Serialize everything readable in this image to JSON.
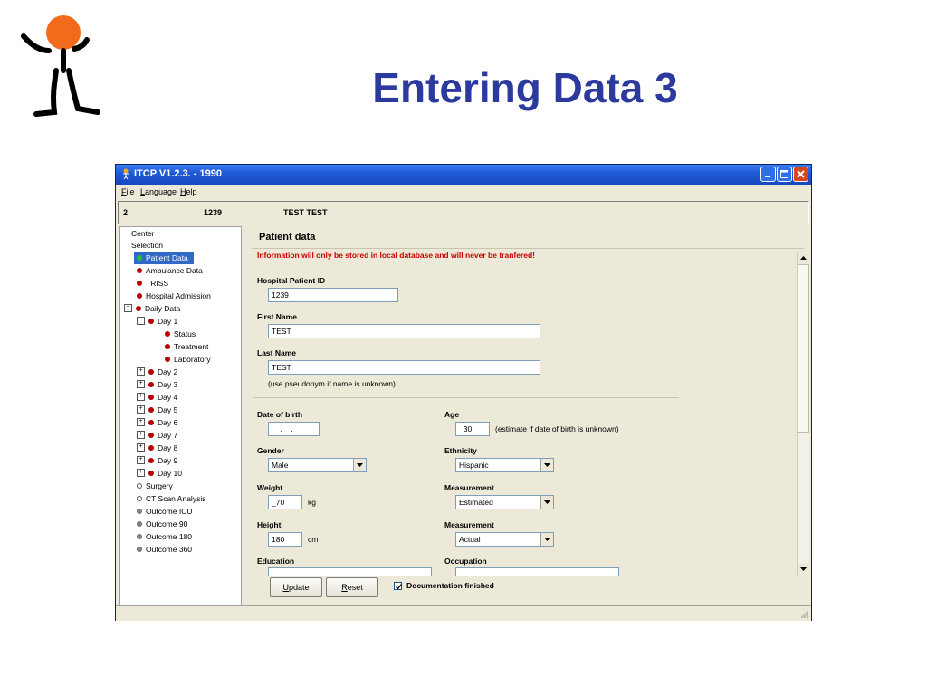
{
  "slide": {
    "title": "Entering Data 3"
  },
  "logo": {
    "icon": "stick-figure-logo-icon",
    "colors": {
      "head": "#f26b1d",
      "body": "#000000"
    }
  },
  "window": {
    "title": "ITCP V1.2.3. - 1990",
    "icon": "app-icon",
    "controls": {
      "minimize": "minimize-icon",
      "maximize": "maximize-icon",
      "close": "close-icon"
    }
  },
  "menu": {
    "file": {
      "hotkey": "F",
      "rest": "ile"
    },
    "language": {
      "hotkey": "L",
      "rest": "anguage"
    },
    "help": {
      "hotkey": "H",
      "rest": "elp"
    }
  },
  "info_bar": {
    "col1": "2",
    "col2": "1239",
    "col3": "TEST TEST"
  },
  "tree": {
    "center": "Center",
    "selection": "Selection",
    "patient_data": "Patient Data",
    "ambulance_data": "Ambulance Data",
    "triss": "TRISS",
    "hospital_admission": "Hospital Admission",
    "daily_data": "Daily Data",
    "day1": "Day 1",
    "status": "Status",
    "treatment": "Treatment",
    "laboratory": "Laboratory",
    "days": [
      "Day 2",
      "Day 3",
      "Day 4",
      "Day 5",
      "Day 6",
      "Day 7",
      "Day 8",
      "Day 9",
      "Day 10"
    ],
    "surgery": "Surgery",
    "ct_scan": "CT Scan Analysis",
    "outcome_icu": "Outcome ICU",
    "outcome_90": "Outcome 90",
    "outcome_180": "Outcome 180",
    "outcome_360": "Outcome 360",
    "expand_symbol": "+",
    "collapse_symbol": "−"
  },
  "form": {
    "title": "Patient data",
    "warning": "Information will only be stored in local database and will never be tranfered!",
    "hospital_id": {
      "label": "Hospital Patient ID",
      "value": "1239"
    },
    "first_name": {
      "label": "First Name",
      "value": "TEST"
    },
    "last_name": {
      "label": "Last Name",
      "value": "TEST"
    },
    "pseudonym_hint": "(use pseudonym if name is unknown)",
    "dob": {
      "label": "Date of birth",
      "value": "__.__.____"
    },
    "age": {
      "label": "Age",
      "value": "_30",
      "hint": "(estimate if date of birth is unknown)"
    },
    "gender": {
      "label": "Gender",
      "value": "Male"
    },
    "ethnicity": {
      "label": "Ethnicity",
      "value": "Hispanic"
    },
    "weight": {
      "label": "Weight",
      "value": "_70",
      "unit": "kg"
    },
    "weight_measurement": {
      "label": "Measurement",
      "value": "Estimated"
    },
    "height": {
      "label": "Height",
      "value": "180",
      "unit": "cm"
    },
    "height_measurement": {
      "label": "Measurement",
      "value": "Actual"
    },
    "education": {
      "label": "Education",
      "value": ""
    },
    "occupation": {
      "label": "Occupation",
      "value": ""
    }
  },
  "actions": {
    "update": {
      "hotkey": "U",
      "rest": "pdate"
    },
    "reset": {
      "hotkey": "R",
      "rest": "eset"
    },
    "documentation_finished": {
      "label": "Documentation finished",
      "checked": true
    }
  },
  "colors": {
    "title_blue": "#2b3a9c",
    "warning_red": "#cc0000",
    "selection_blue": "#316ac5",
    "titlebar_blue": "#1f5bd6"
  }
}
